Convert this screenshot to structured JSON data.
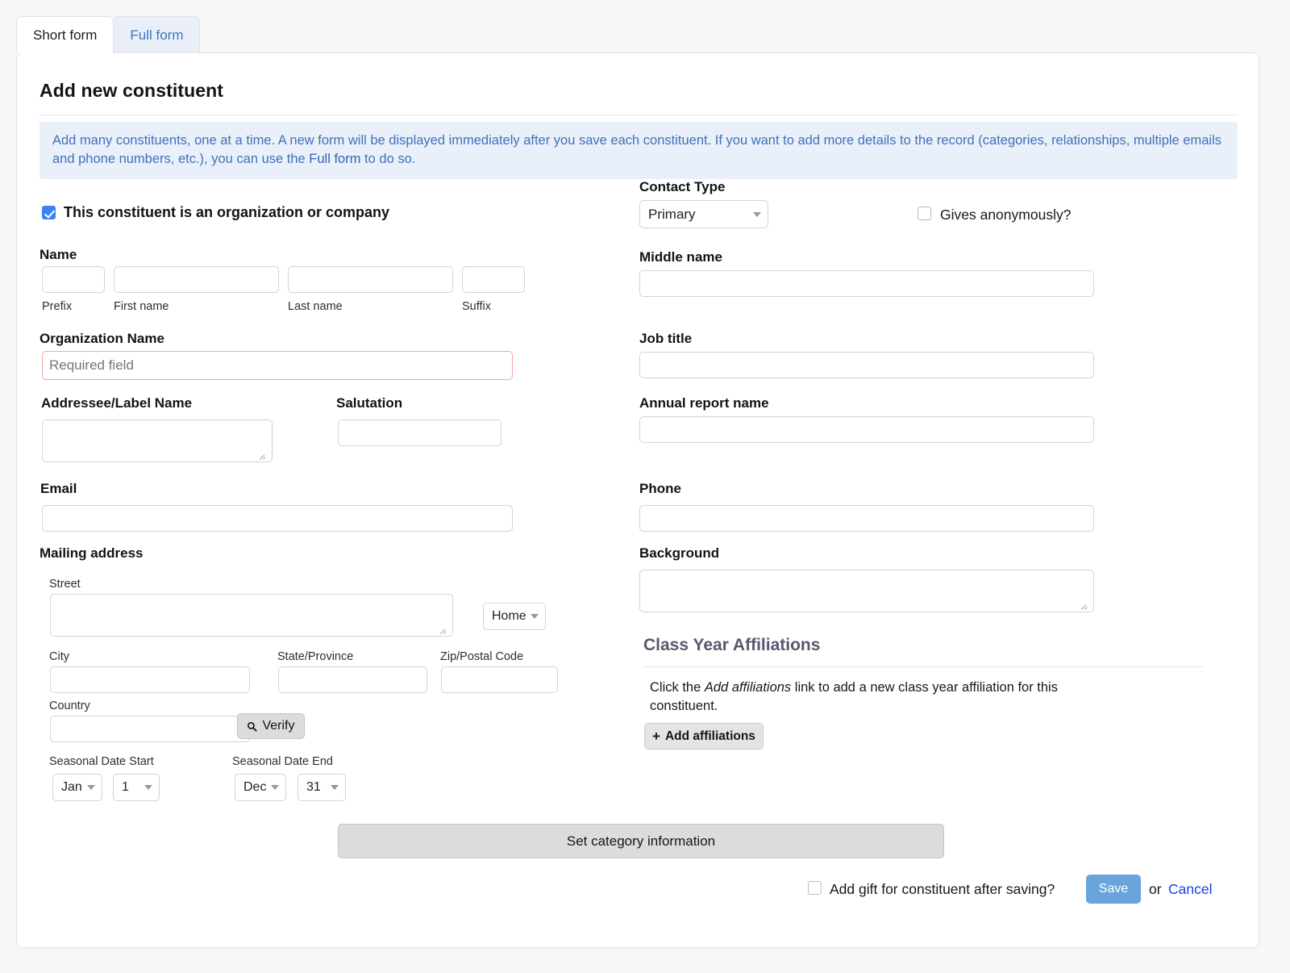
{
  "tabs": [
    {
      "label": "Short form",
      "active": true
    },
    {
      "label": "Full form",
      "active": false
    }
  ],
  "header": {
    "title": "Add new constituent"
  },
  "banner": {
    "text_part1": "Add many constituents, one at a time. A new form will be displayed immediately after you save each constituent. If you want to add more details to the record (categories, relationships, multiple emails and phone numbers, etc.), you can use the ",
    "link_label": "Full form",
    "text_part2": " to do so."
  },
  "left": {
    "org_checkbox": {
      "label": "This constituent is an organization or company",
      "checked": true
    },
    "name": {
      "label": "Name",
      "prefix": {
        "label": "Prefix",
        "value": ""
      },
      "first": {
        "label": "First name",
        "value": ""
      },
      "last": {
        "label": "Last name",
        "value": ""
      },
      "suffix": {
        "label": "Suffix",
        "value": ""
      }
    },
    "organization_name": {
      "label": "Organization Name",
      "value": "",
      "placeholder": "Required field"
    },
    "addressee": {
      "label": "Addressee/Label Name",
      "value": ""
    },
    "salutation": {
      "label": "Salutation",
      "value": ""
    },
    "email": {
      "label": "Email",
      "value": ""
    },
    "mailing": {
      "label": "Mailing address",
      "street": {
        "label": "Street",
        "value": ""
      },
      "address_type": {
        "value": "Home"
      },
      "city": {
        "label": "City",
        "value": ""
      },
      "state": {
        "label": "State/Province",
        "value": ""
      },
      "zip": {
        "label": "Zip/Postal Code",
        "value": ""
      },
      "country": {
        "label": "Country",
        "value": ""
      },
      "verify_button": {
        "label": "Verify",
        "icon": "search-icon"
      }
    },
    "seasonal": {
      "start_label": "Seasonal Date Start",
      "start_month": "Jan",
      "start_day": "1",
      "end_label": "Seasonal Date End",
      "end_month": "Dec",
      "end_day": "31"
    }
  },
  "right": {
    "contact_type": {
      "label": "Contact Type",
      "value": "Primary"
    },
    "gives_anonymously": {
      "label": "Gives anonymously?",
      "checked": false
    },
    "middle_name": {
      "label": "Middle name",
      "value": ""
    },
    "job_title": {
      "label": "Job title",
      "value": ""
    },
    "annual_report_name": {
      "label": "Annual report name",
      "value": ""
    },
    "phone": {
      "label": "Phone",
      "value": ""
    },
    "background": {
      "label": "Background",
      "value": ""
    },
    "class_year": {
      "heading": "Class Year Affiliations",
      "desc_part1": "Click the ",
      "desc_em": "Add affiliations",
      "desc_part2": " link to add a new class year affiliation for this constituent.",
      "add_button": "Add affiliations",
      "add_icon": "plus-icon"
    }
  },
  "footer": {
    "category_button": "Set category information",
    "add_gift": {
      "label": "Add gift for constituent after saving?",
      "checked": false
    },
    "save_label": "Save",
    "or_label": "or",
    "cancel_label": "Cancel"
  },
  "colors": {
    "accent_blue": "#6aa4dd",
    "link_blue": "#1a40e8",
    "banner_blue": "#3f72b8",
    "required_red": "#f4685e",
    "section_head": "#56596e"
  }
}
